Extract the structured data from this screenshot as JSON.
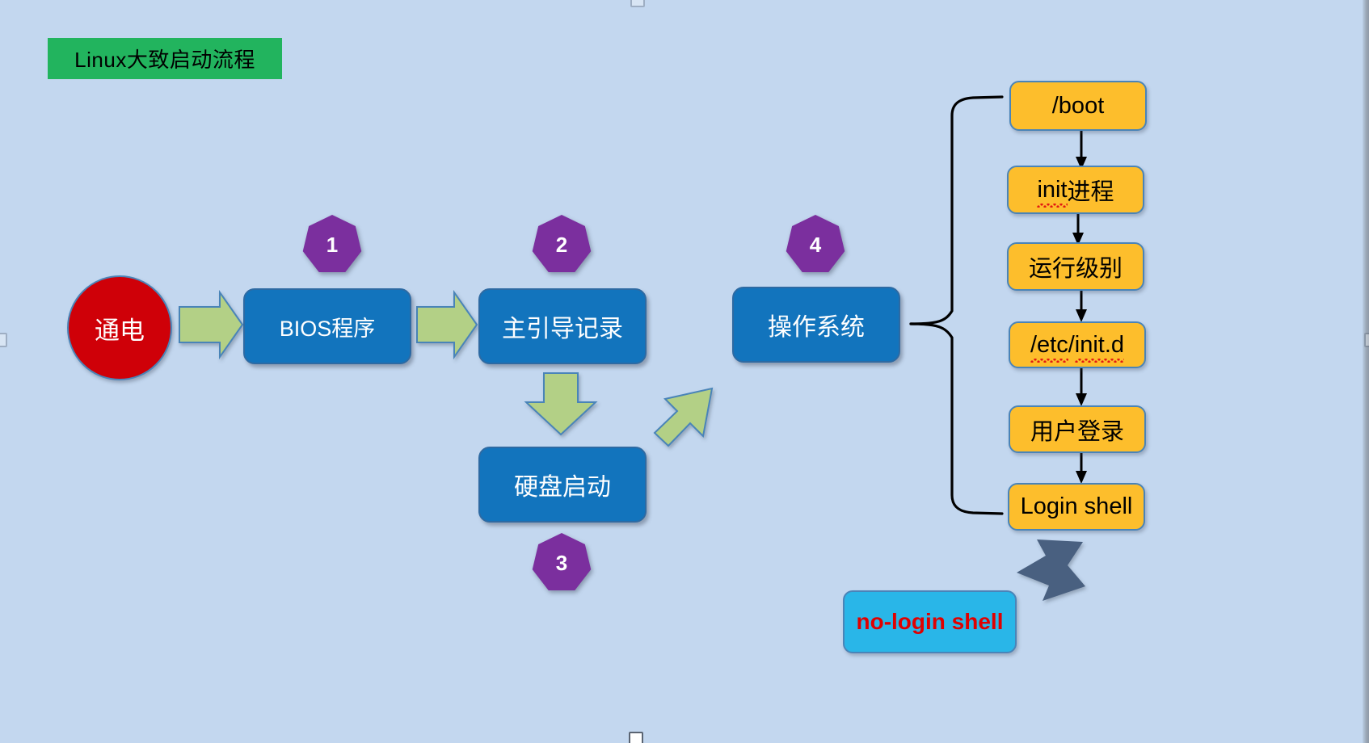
{
  "title": {
    "text": "Linux大致启动流程"
  },
  "nodes": {
    "power": "通电",
    "bios": "BIOS程序",
    "mbr": "主引导记录",
    "disk": "硬盘启动",
    "os": "操作系统",
    "boot": "/boot",
    "init_prefix": "init",
    "init_suffix": "进程",
    "runlevel": "运行级别",
    "initd_a": "/etc",
    "initd_sep": "/",
    "initd_b": "init.d",
    "user_login": "用户登录",
    "login_shell": "Login shell",
    "no_login_shell": "no-login shell"
  },
  "badges": {
    "one": "1",
    "two": "2",
    "three": "3",
    "four": "4"
  },
  "colors": {
    "background": "#c3d7ef",
    "title_bg": "#22b45e",
    "circle": "#cf0008",
    "blue_box": "#1274bd",
    "yellow_box": "#fdbe2c",
    "cyan_box": "#29b6e8",
    "badge": "#7b2f9e",
    "green_arrow": "#b3d086",
    "gray_arrow": "#4a6party"
  },
  "chart_data": {
    "type": "diagram",
    "title": "Linux大致启动流程",
    "flow_main": [
      "通电",
      "BIOS程序",
      "主引导记录",
      "硬盘启动",
      "操作系统"
    ],
    "flow_detail": [
      "/boot",
      "init进程",
      "运行级别",
      "/etc/init.d",
      "用户登录",
      "Login shell"
    ],
    "side_note": "no-login shell",
    "step_labels": {
      "BIOS程序": "1",
      "主引导记录": "2",
      "硬盘启动": "3",
      "操作系统": "4"
    }
  }
}
